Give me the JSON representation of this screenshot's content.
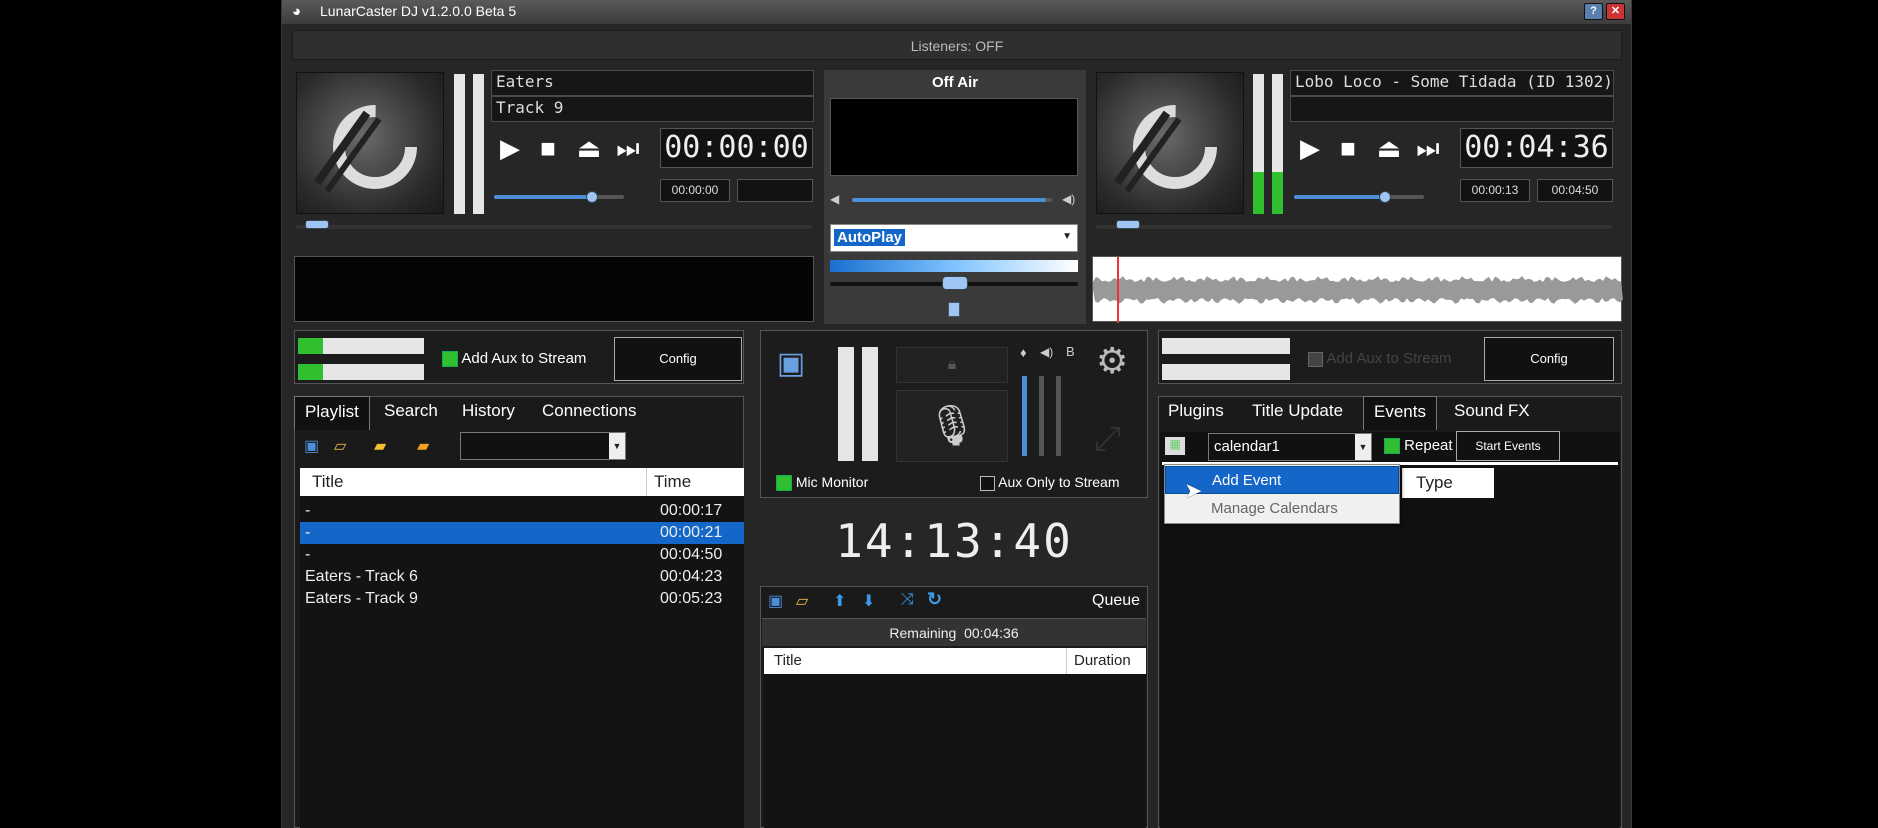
{
  "window": {
    "title": "LunarCaster DJ v1.2.0.0 Beta 5"
  },
  "status": {
    "listeners": "Listeners: OFF"
  },
  "deck_a": {
    "artist": "Eaters",
    "track": "Track 9",
    "main_time": "00:00:00",
    "elapsed": "00:00:00",
    "remaining": "",
    "volume": 0.75,
    "position": 0.03
  },
  "deck_b": {
    "title": "Lobo Loco - Some Tidada (ID 1302)",
    "subtitle": "",
    "main_time": "00:04:36",
    "elapsed": "00:00:13",
    "remaining": "00:04:50",
    "volume": 0.7,
    "position": 0.05
  },
  "center": {
    "onair": "Off Air",
    "mode_selected": "AutoPlay",
    "crossfade_volume": 0.97,
    "clock": "14:13:40"
  },
  "aux_left": {
    "label": "Add Aux to Stream",
    "config": "Config"
  },
  "aux_right": {
    "label": "Add Aux to Stream",
    "config": "Config"
  },
  "mic": {
    "monitor": "Mic Monitor",
    "aux_only": "Aux Only to Stream",
    "b_label": "B"
  },
  "left_tabs": [
    "Playlist",
    "Search",
    "History",
    "Connections"
  ],
  "playlist": {
    "columns": {
      "title": "Title",
      "time": "Time"
    },
    "rows": [
      {
        "title": "-",
        "time": "00:00:17",
        "selected": false
      },
      {
        "title": "-",
        "time": "00:00:21",
        "selected": true
      },
      {
        "title": "-",
        "time": "00:04:50",
        "selected": false
      },
      {
        "title": "Eaters - Track 6",
        "time": "00:04:23",
        "selected": false
      },
      {
        "title": "Eaters - Track 9",
        "time": "00:05:23",
        "selected": false
      }
    ]
  },
  "queue": {
    "label": "Queue",
    "remaining_label": "Remaining",
    "remaining_value": "00:04:36",
    "columns": {
      "title": "Title",
      "duration": "Duration"
    }
  },
  "right_tabs": [
    "Plugins",
    "Title Update",
    "Events",
    "Sound FX"
  ],
  "events": {
    "calendar": "calendar1",
    "repeat": "Repeat",
    "start": "Start Events",
    "type_col": "Type",
    "menu": [
      "Add Event",
      "Manage Calendars"
    ]
  },
  "colors": {
    "accent": "#1466c8",
    "meter": "#2fbf2f",
    "window": "#262626"
  }
}
